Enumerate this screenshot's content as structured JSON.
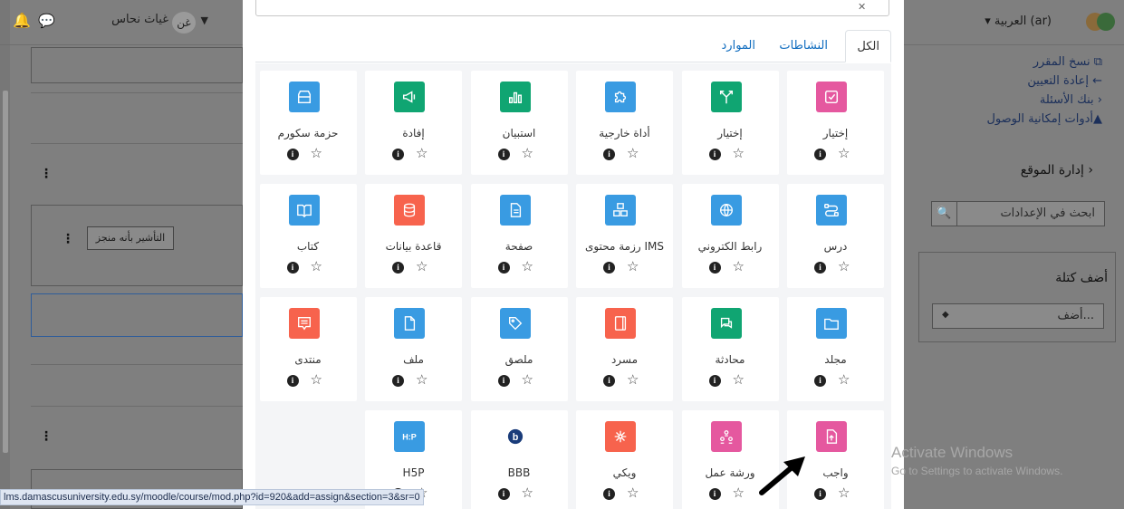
{
  "background": {
    "user_name": "غياث نحاس",
    "user_initials": "غن",
    "mark_done_button": "التأشير بأنه منجز",
    "status_url": "lms.damascusuniversity.edu.sy/moodle/course/mod.php?id=920&add=assign&section=3&sr=0",
    "language_menu": "العربية (ar)",
    "side_links": [
      "نسخ المقرر",
      "إعادة التعيين",
      "بنك الأسئلة",
      "أدوات إمكانية الوصول"
    ],
    "site_admin": "إدارة الموقع",
    "search_placeholder": "ابحث في الإعدادات",
    "add_block_title": "أضف كتلة",
    "add_block_select": "أضف...",
    "watermark_title": "Activate Windows",
    "watermark_sub": "Go to Settings to activate Windows."
  },
  "modal": {
    "tabs": [
      "الكل",
      "النشاطات",
      "الموارد"
    ],
    "active_tab": "الكل",
    "tiles": [
      {
        "name": "إختيار",
        "icon": "checkbox-icon",
        "color": "#e5589f"
      },
      {
        "name": "إختيار",
        "icon": "fork-icon",
        "color": "#10a572"
      },
      {
        "name": "أداة خارجية",
        "icon": "puzzle-icon",
        "color": "#399be2"
      },
      {
        "name": "استبيان",
        "icon": "bars-icon",
        "color": "#10a572"
      },
      {
        "name": "إفادة",
        "icon": "megaphone-icon",
        "color": "#10a572"
      },
      {
        "name": "حزمة سكورم",
        "icon": "package-icon",
        "color": "#399be2"
      },
      {
        "name": "درس",
        "icon": "path-icon",
        "color": "#399be2"
      },
      {
        "name": "رابط الكتروني",
        "icon": "globe-icon",
        "color": "#399be2"
      },
      {
        "name": "رزمة محتوى IMS",
        "icon": "blocks-icon",
        "color": "#399be2"
      },
      {
        "name": "صفحة",
        "icon": "page-icon",
        "color": "#399be2"
      },
      {
        "name": "قاعدة بيانات",
        "icon": "database-icon",
        "color": "#f7634d"
      },
      {
        "name": "كتاب",
        "icon": "book-icon",
        "color": "#399be2"
      },
      {
        "name": "مجلد",
        "icon": "folder-icon",
        "color": "#399be2"
      },
      {
        "name": "محادثة",
        "icon": "chat-icon",
        "color": "#10a572"
      },
      {
        "name": "مسرد",
        "icon": "glossary-icon",
        "color": "#f7634d"
      },
      {
        "name": "ملصق",
        "icon": "tag-icon",
        "color": "#399be2"
      },
      {
        "name": "ملف",
        "icon": "file-icon",
        "color": "#399be2"
      },
      {
        "name": "منتدى",
        "icon": "forum-icon",
        "color": "#f7634d"
      },
      {
        "name": "واجب",
        "icon": "upload-file-icon",
        "color": "#e5589f"
      },
      {
        "name": "ورشة عمل",
        "icon": "workshop-icon",
        "color": "#e5589f"
      },
      {
        "name": "ويكي",
        "icon": "wiki-icon",
        "color": "#f7634d"
      },
      {
        "name": "BBB",
        "icon": "bbb-icon",
        "color": "#ffffff"
      },
      {
        "name": "H5P",
        "icon": "h5p-icon",
        "color": "#399be2"
      }
    ]
  }
}
